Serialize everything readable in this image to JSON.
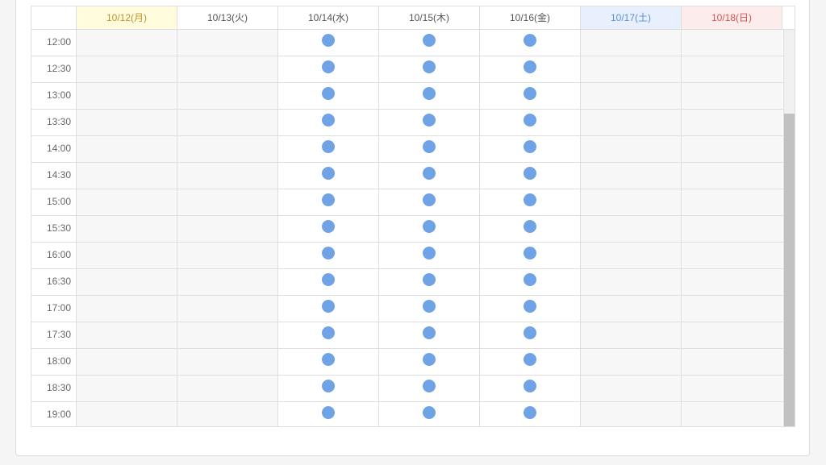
{
  "colors": {
    "available_dot": "#6fa3e6",
    "weekday_header_text": "#555555",
    "monday_header_bg": "#fffbdc",
    "monday_header_text": "#b8962d",
    "saturday_header_bg": "#e8f0fd",
    "saturday_header_text": "#5a8fd6",
    "sunday_header_bg": "#fdecec",
    "sunday_header_text": "#d9534f"
  },
  "days": [
    {
      "label": "10/12(月)",
      "kind": "monday"
    },
    {
      "label": "10/13(火)",
      "kind": "weekday"
    },
    {
      "label": "10/14(水)",
      "kind": "weekday"
    },
    {
      "label": "10/15(木)",
      "kind": "weekday"
    },
    {
      "label": "10/16(金)",
      "kind": "weekday"
    },
    {
      "label": "10/17(土)",
      "kind": "saturday"
    },
    {
      "label": "10/18(日)",
      "kind": "sunday"
    }
  ],
  "times": [
    "12:00",
    "12:30",
    "13:00",
    "13:30",
    "14:00",
    "14:30",
    "15:00",
    "15:30",
    "16:00",
    "16:30",
    "17:00",
    "17:30",
    "18:00",
    "18:30",
    "19:00"
  ],
  "availability": [
    false,
    false,
    true,
    true,
    true,
    false,
    false
  ],
  "available_icon": "circle-dot-icon"
}
